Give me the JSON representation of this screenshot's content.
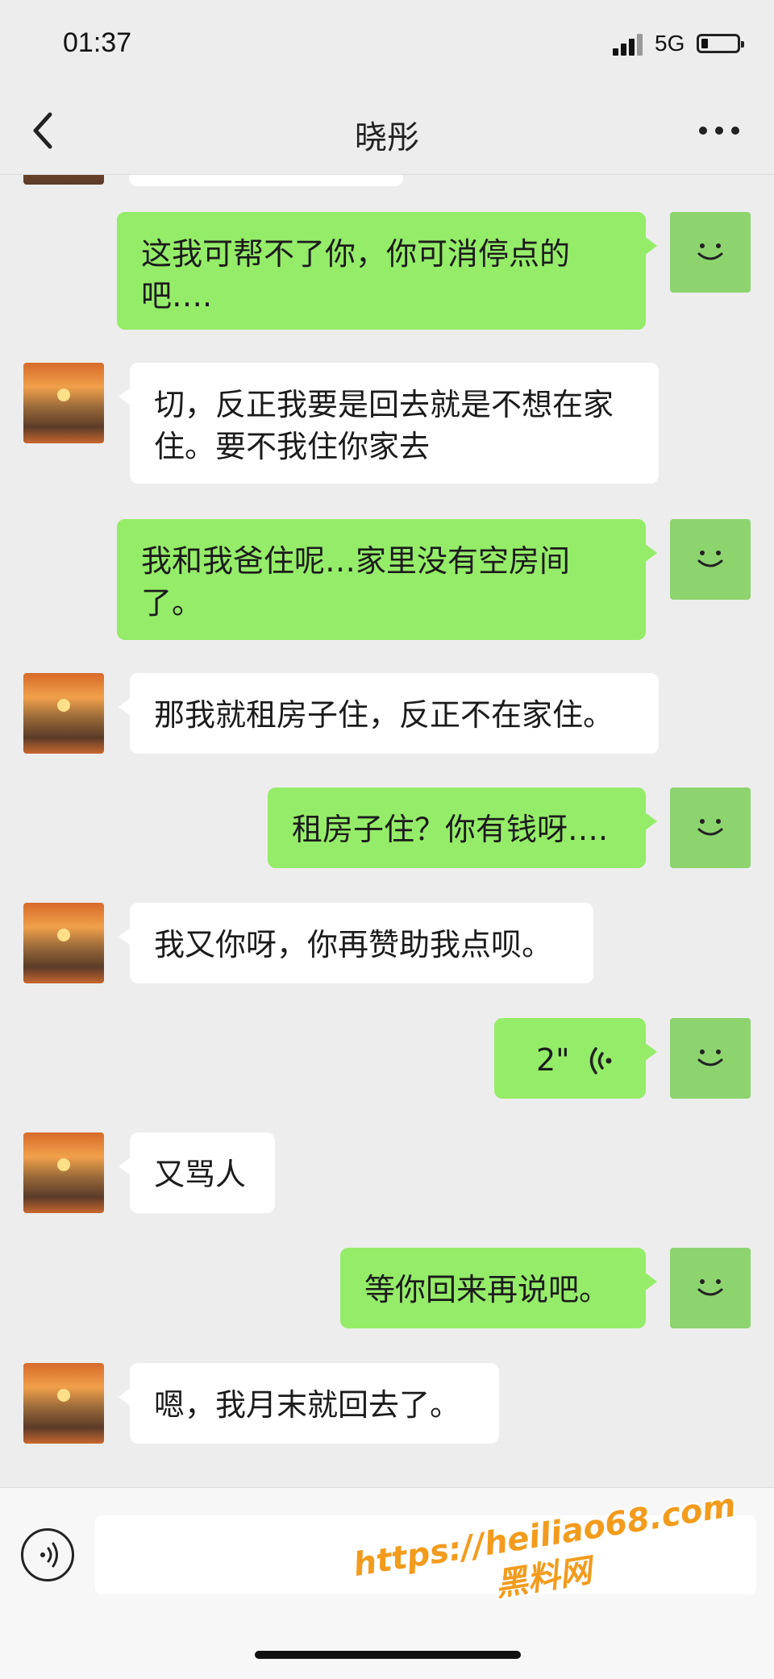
{
  "status_bar": {
    "time": "01:37",
    "network": "5G",
    "battery_percent": 20
  },
  "header": {
    "title": "晓彤"
  },
  "messages": [
    {
      "from": "me",
      "type": "text",
      "text": "这我可帮不了你，你可消停点的吧…."
    },
    {
      "from": "other",
      "type": "text",
      "text": "切，反正我要是回去就是不想在家住。要不我住你家去"
    },
    {
      "from": "me",
      "type": "text",
      "text": "我和我爸住呢…家里没有空房间了。"
    },
    {
      "from": "other",
      "type": "text",
      "text": "那我就租房子住，反正不在家住。"
    },
    {
      "from": "me",
      "type": "text",
      "text": "租房子住？你有钱呀…."
    },
    {
      "from": "other",
      "type": "text",
      "text": "我又你呀，你再赞助我点呗。"
    },
    {
      "from": "me",
      "type": "voice",
      "duration": "2\""
    },
    {
      "from": "other",
      "type": "text",
      "text": "又骂人"
    },
    {
      "from": "me",
      "type": "text",
      "text": "等你回来再说吧。"
    },
    {
      "from": "other",
      "type": "text",
      "text": "嗯，我月末就回去了。"
    }
  ],
  "watermark": {
    "line1": "https://heiliao68.com",
    "line2": "黑料网"
  },
  "colors": {
    "background": "#ededed",
    "my_bubble": "#95ec69",
    "other_bubble": "#ffffff",
    "watermark": "#f29b1d"
  },
  "icons": {
    "back": "chevron-left-icon",
    "more": "ellipsis-icon",
    "voice": "voice-wave-icon",
    "voice_toggle": "voice-input-icon"
  }
}
